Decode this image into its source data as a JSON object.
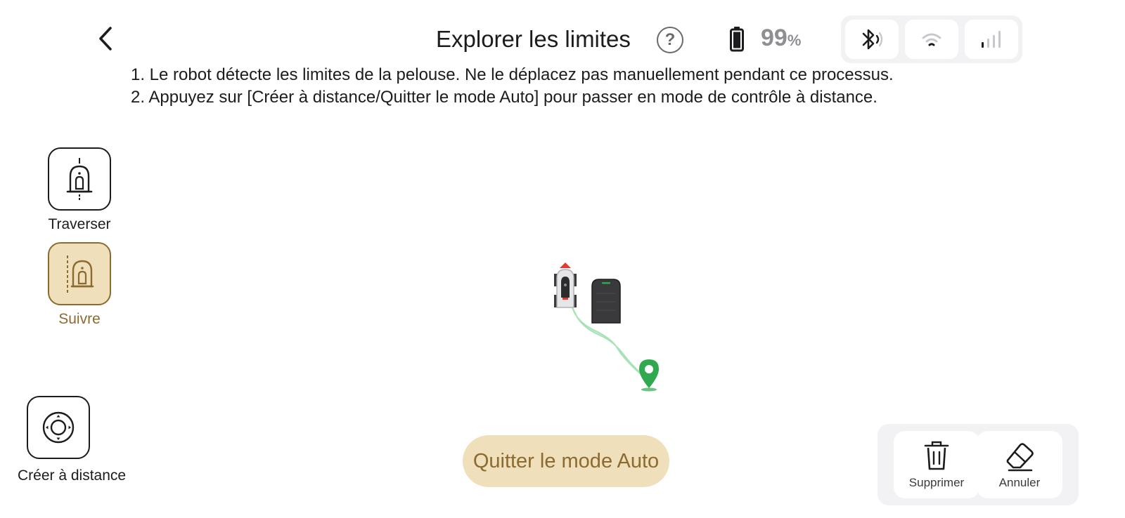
{
  "header": {
    "title": "Explorer les limites",
    "help_icon_text": "?",
    "battery": {
      "value": "99",
      "unit": "%"
    },
    "connections": [
      {
        "name": "bluetooth-icon",
        "state": "active"
      },
      {
        "name": "wifi-icon",
        "state": "inactive"
      },
      {
        "name": "cellular-signal-icon",
        "state": "inactive"
      }
    ]
  },
  "instructions": [
    "1. Le robot détecte les limites de la pelouse. Ne le déplacez pas manuellement pendant ce processus.",
    "2. Appuyez sur [Créer à distance/Quitter le mode Auto] pour passer en mode de contrôle à distance."
  ],
  "modes": {
    "traverse": {
      "label": "Traverser",
      "active": false
    },
    "follow": {
      "label": "Suivre",
      "active": true
    }
  },
  "remote": {
    "label": "Créer à distance"
  },
  "actions": {
    "exit_auto": "Quitter le mode Auto",
    "delete": "Supprimer",
    "undo": "Annuler"
  },
  "colors": {
    "accent": "#8c6a30",
    "accent_bg": "#efdfbb",
    "marker": "#2fa84f",
    "heading_arrow": "#e53935",
    "path": "#9fe0b0"
  }
}
